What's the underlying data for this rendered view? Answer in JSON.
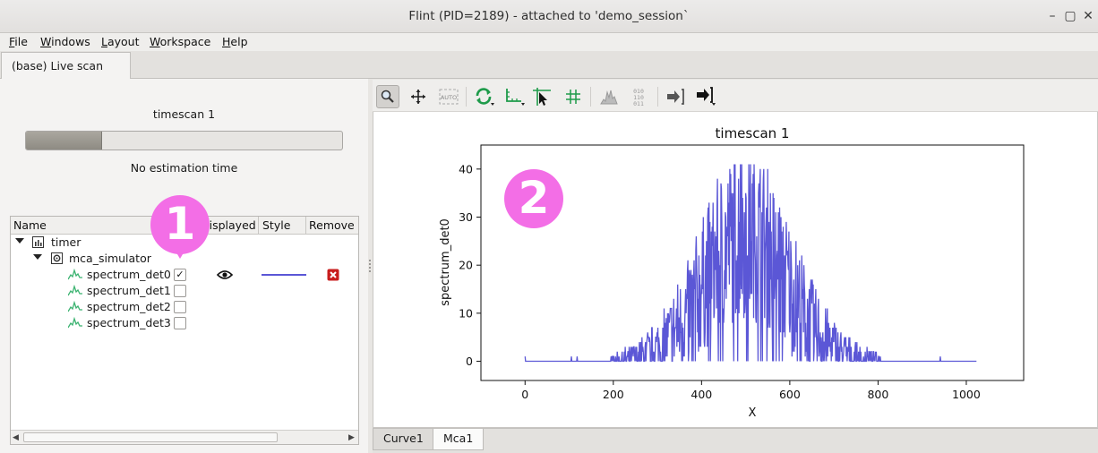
{
  "window": {
    "title": "Flint (PID=2189) - attached to 'demo_session`",
    "minimize_glyph": "–",
    "maximize_glyph": "▢",
    "close_glyph": "✕"
  },
  "menubar": {
    "items": [
      {
        "first": "F",
        "rest": "ile"
      },
      {
        "first": "W",
        "rest": "indows"
      },
      {
        "first": "L",
        "rest": "ayout"
      },
      {
        "first": "W",
        "rest": "orkspace"
      },
      {
        "first": "H",
        "rest": "elp"
      }
    ]
  },
  "main_tab": {
    "label": "(base) Live scan"
  },
  "scan": {
    "title": "timescan 1",
    "progress": 0.24,
    "estimation": "No estimation time"
  },
  "tree": {
    "columns": [
      "Name",
      "Displayed",
      "Style",
      "Remove"
    ],
    "root": "timer",
    "device": "mca_simulator",
    "channels": [
      {
        "name": "spectrum_det0",
        "checked": true,
        "check_glyph": "✓"
      },
      {
        "name": "spectrum_det1",
        "checked": false,
        "check_glyph": ""
      },
      {
        "name": "spectrum_det2",
        "checked": false,
        "check_glyph": ""
      },
      {
        "name": "spectrum_det3",
        "checked": false,
        "check_glyph": ""
      }
    ],
    "style_color": "#5b57d6",
    "remove_color": "#c81e1e"
  },
  "toolbar": {
    "icons": [
      "zoom-icon",
      "pan-icon",
      "autoscale-icon",
      "refresh-icon",
      "axes-icon",
      "crosshair-icon",
      "grid-icon",
      "histogram-icon",
      "binary-data-icon",
      "export-icon",
      "copy-icon"
    ]
  },
  "bottom_tabs": [
    "Curve1",
    "Mca1"
  ],
  "badges": {
    "one": "1",
    "two": "2",
    "color": "#f36ee6"
  },
  "chart_data": {
    "type": "line",
    "title": "timescan 1",
    "xlabel": "X",
    "ylabel": "spectrum_det0",
    "xlim": [
      -100,
      1130
    ],
    "ylim": [
      -4,
      45
    ],
    "xticks": [
      0,
      200,
      400,
      600,
      800,
      1000
    ],
    "yticks": [
      0,
      10,
      20,
      30,
      40
    ],
    "grid": false,
    "color": "#5b57d6",
    "series": [
      {
        "x_start": 0,
        "x_end": 1023,
        "x_step": 1,
        "peak_center": 500,
        "peak_sigma": 95,
        "peak_height": 27,
        "max_value": 41
      }
    ]
  }
}
